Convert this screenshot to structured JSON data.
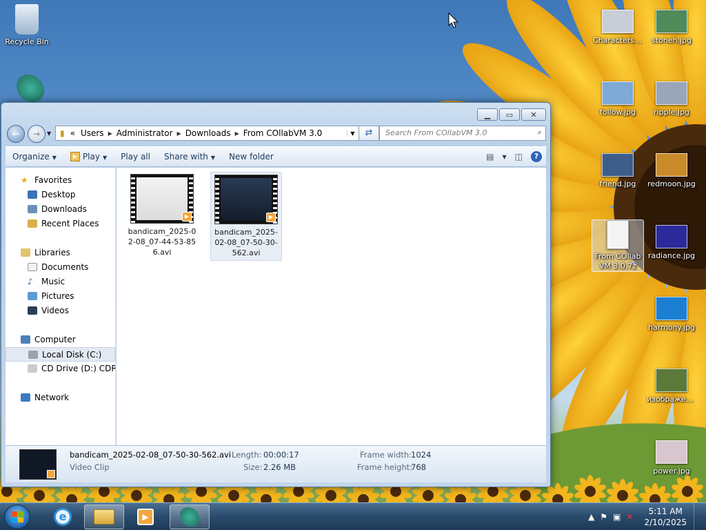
{
  "desktop": {
    "icons_left": [
      {
        "label": "Recycle Bin",
        "icon": "recycle-bin-icon"
      }
    ],
    "icons_right": [
      {
        "label": "Characters....",
        "icon": "image-file-icon",
        "color": "#c9ced6"
      },
      {
        "label": "stoneh.jpg",
        "icon": "image-file-icon",
        "color": "#4f8a5a"
      },
      {
        "label": "follow.jpg",
        "icon": "image-file-icon",
        "color": "#7fa9d6"
      },
      {
        "label": "ripple.jpg",
        "icon": "image-file-icon",
        "color": "#9aa6b7"
      },
      {
        "label": "friend.jpg",
        "icon": "image-file-icon",
        "color": "#3e5d8a"
      },
      {
        "label": "redmoon.jpg",
        "icon": "image-file-icon",
        "color": "#c98a2a"
      },
      {
        "label": "From COllabVM 3.0.7z",
        "icon": "archive-file-icon",
        "color": "#f4f4f4"
      },
      {
        "label": "radiance.jpg",
        "icon": "image-file-icon",
        "color": "#2b2a9a"
      },
      {
        "label": "harmony.jpg",
        "icon": "image-file-icon",
        "color": "#1d7fd4"
      },
      {
        "label": "изображен...",
        "icon": "image-file-icon",
        "color": "#5b7a3a"
      },
      {
        "label": "power.jpg",
        "icon": "image-file-icon",
        "color": "#d8c6cf"
      }
    ]
  },
  "window": {
    "address": {
      "segments": [
        "«",
        "Users",
        "Administrator",
        "Downloads",
        "From COllabVM 3.0"
      ]
    },
    "search_placeholder": "Search From COllabVM 3.0",
    "toolbar": {
      "organize": "Organize",
      "play": "Play",
      "play_all": "Play all",
      "share_with": "Share with",
      "new_folder": "New folder"
    },
    "nav": {
      "favorites": "Favorites",
      "desktop": "Desktop",
      "downloads": "Downloads",
      "recent_places": "Recent Places",
      "libraries": "Libraries",
      "documents": "Documents",
      "music": "Music",
      "pictures": "Pictures",
      "videos": "Videos",
      "computer": "Computer",
      "local_disk": "Local Disk (C:)",
      "cd_drive": "CD Drive (D:) CDROM",
      "network": "Network"
    },
    "files": [
      {
        "name": "bandicam_2025-02-08_07-44-53-856.avi",
        "selected": false
      },
      {
        "name": "bandicam_2025-02-08_07-50-30-562.avi",
        "selected": true
      }
    ],
    "details": {
      "filename": "bandicam_2025-02-08_07-50-30-562.avi",
      "type": "Video Clip",
      "length_label": "Length:",
      "length_value": "00:00:17",
      "size_label": "Size:",
      "size_value": "2.26 MB",
      "frame_width_label": "Frame width:",
      "frame_width_value": "1024",
      "frame_height_label": "Frame height:",
      "frame_height_value": "768"
    }
  },
  "taskbar": {
    "time": "5:11 AM",
    "date": "2/10/2025"
  }
}
